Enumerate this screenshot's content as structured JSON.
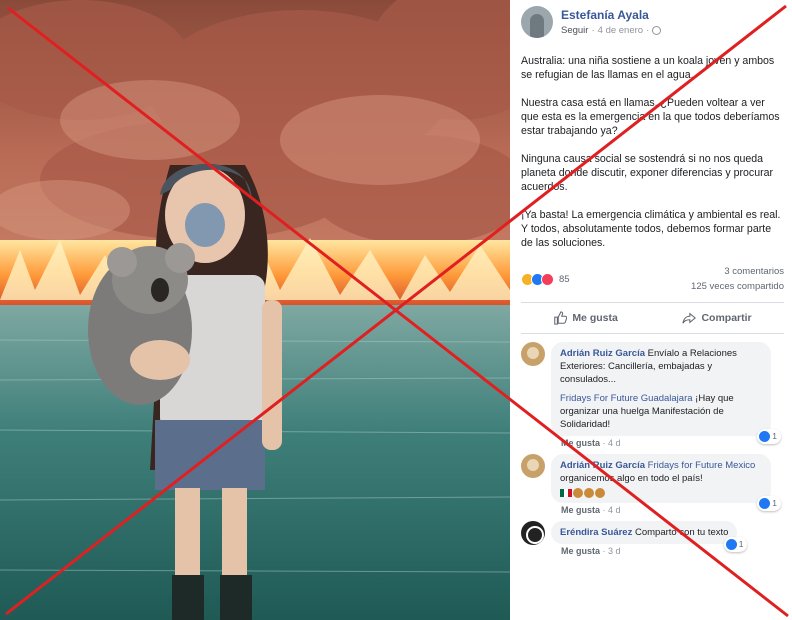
{
  "post": {
    "author": "Estefanía Ayala",
    "follow": "Seguir",
    "date": "4 de enero",
    "paragraphs": [
      "Australia: una niña sostiene a un koala joven y ambos se refugian de las llamas en el agua.",
      "Nuestra casa está en llamas. ¿Pueden voltear a ver que esta es la emergencia en la que todos deberíamos estar trabajando ya?",
      "Ninguna causa social se sostendrá si no nos queda planeta donde discutir, exponer diferencias y procurar acuerdos.",
      "¡Ya basta! La emergencia climática y ambiental es real. Y todos, absolutamente todos, debemos formar parte de las soluciones."
    ],
    "reaction_count": "85",
    "comments_count": "3 comentarios",
    "shares_count": "125 veces compartido",
    "like_action": "Me gusta",
    "share_action": "Compartir"
  },
  "comments": [
    {
      "author": "Adrián Ruiz García",
      "text": "Envíalo a Relaciones Exteriores: Cancillería, embajadas y consulados...",
      "reply_author": "Fridays For Future Guadalajara",
      "reply_text": " ¡Hay que organizar una huelga Manifestación de Solidaridad!",
      "like": "Me gusta",
      "time": "4 d",
      "likes": "1"
    },
    {
      "author": "Adrián Ruiz García",
      "tag": "Fridays for Future Mexico",
      "text": " organicemos algo en todo el país!",
      "like": "Me gusta",
      "time": "4 d",
      "likes": "1"
    },
    {
      "author": "Eréndira Suárez",
      "text": "Comparto con tu texto",
      "like": "Me gusta",
      "time": "3 d",
      "likes": "1"
    }
  ],
  "colors": {
    "link": "#385898",
    "xmark": "#e02020",
    "like_blue": "#2078f4"
  },
  "icons": [
    "globe-icon",
    "like-thumb-icon",
    "share-arrow-icon",
    "sad-reaction-icon",
    "like-reaction-icon",
    "love-reaction-icon"
  ]
}
